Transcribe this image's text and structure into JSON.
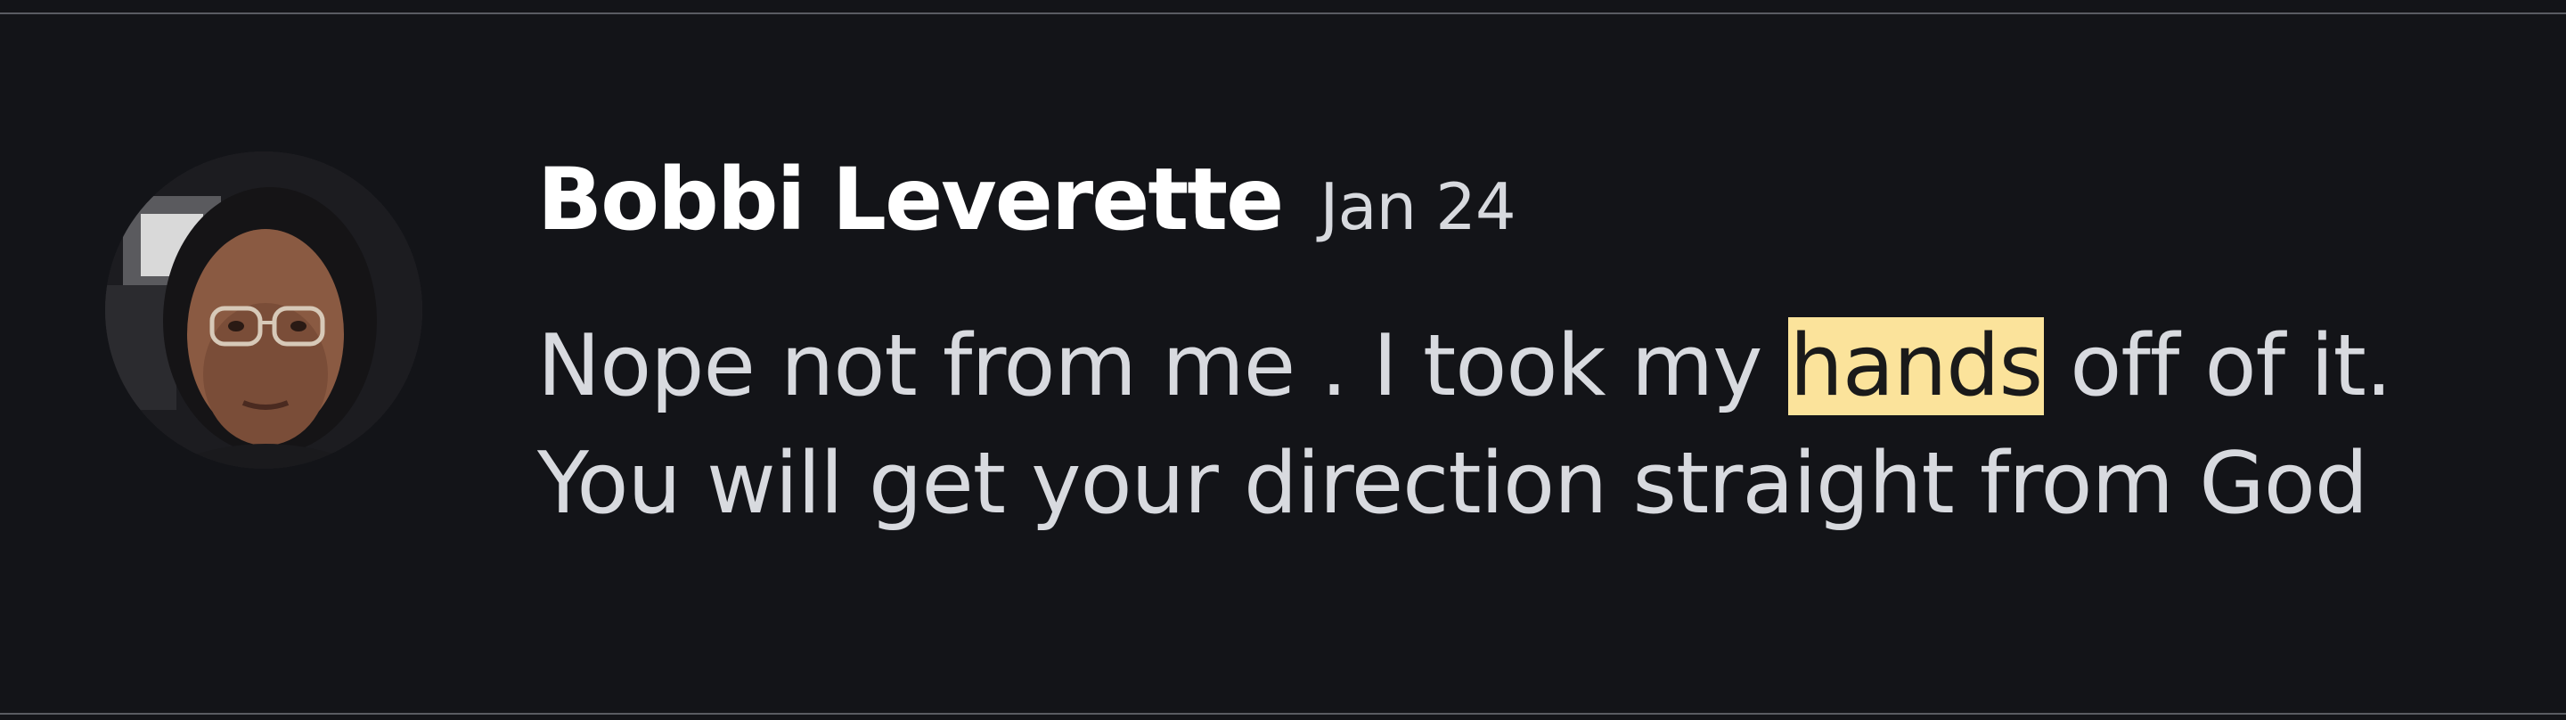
{
  "comment": {
    "author": "Bobbi Leverette",
    "date": "Jan 24",
    "message_before": "Nope not from me . I took my ",
    "message_highlight": "hands",
    "message_after": " off of it.",
    "message_line2": "You will get your direction straight from God"
  },
  "colors": {
    "background": "#131418",
    "highlight": "#fbe39b",
    "author_text": "#ffffff",
    "body_text": "#d8dadf"
  }
}
